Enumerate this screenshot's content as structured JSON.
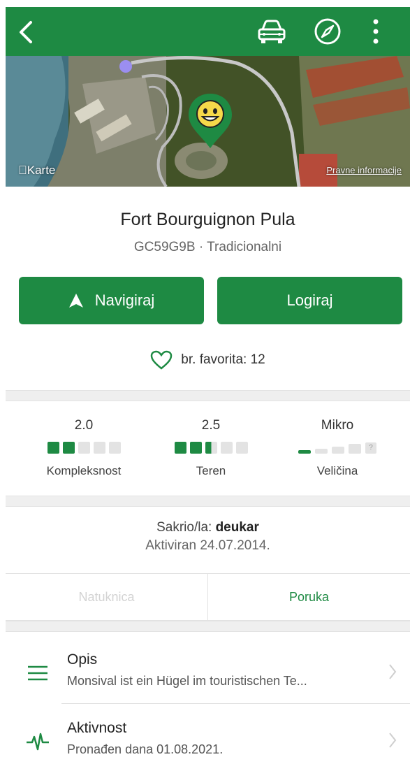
{
  "colors": {
    "brand": "#1e8a43",
    "separator": "#efefef"
  },
  "toolbar": {
    "back_icon": "chevron-left-icon",
    "car_icon": "car-icon",
    "compass_icon": "compass-icon",
    "more_icon": "more-vertical-icon"
  },
  "map": {
    "attribution": "Karte",
    "legal": "Pravne informacije",
    "pin_icon": "smiley-pin-icon"
  },
  "cache": {
    "name": "Fort Bourguignon Pula",
    "code_type": "GC59G9B · Tradicionalni"
  },
  "actions": {
    "navigate_label": "Navigiraj",
    "log_label": "Logiraj"
  },
  "favorites": {
    "text": "br. favorita: 12"
  },
  "ratings": {
    "difficulty": {
      "value": "2.0",
      "label": "Kompleksnost",
      "level": 2.0,
      "max": 5
    },
    "terrain": {
      "value": "2.5",
      "label": "Teren",
      "level": 2.5,
      "max": 5
    },
    "size": {
      "value": "Mikro",
      "label": "Veličina",
      "level": 1,
      "max": 4
    }
  },
  "owner": {
    "prefix": "Sakrio/la: ",
    "name": "deukar",
    "activated": "Aktiviran 24.07.2014."
  },
  "tabs": [
    {
      "label": "Natuknica",
      "enabled": false
    },
    {
      "label": "Poruka",
      "enabled": true
    }
  ],
  "rows": [
    {
      "title": "Opis",
      "detail": "Monsival ist ein Hügel im touristischen Te...",
      "icon": "list-icon"
    },
    {
      "title": "Aktivnost",
      "detail": "Pronađen dana 01.08.2021.",
      "icon": "activity-icon"
    }
  ]
}
